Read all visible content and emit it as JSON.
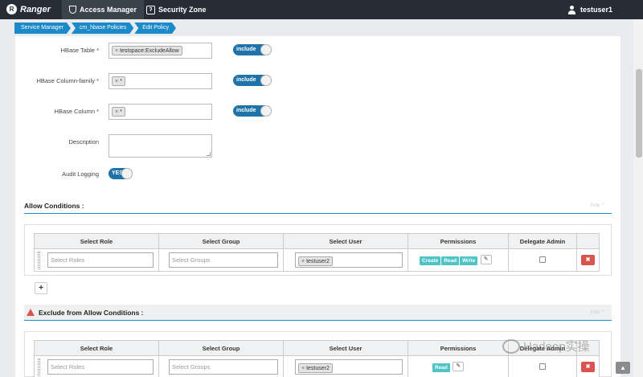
{
  "topnav": {
    "brand": "Ranger",
    "access_manager": "Access Manager",
    "security_zone": "Security Zone",
    "user": "testuser1"
  },
  "breadcrumb": [
    "Service Manager",
    "cm_hbase Policies",
    "Edit Policy"
  ],
  "form": {
    "hbase_table_label": "HBase Table *",
    "hbase_table_value": "testspace:ExcludeAllow",
    "hbase_table_toggle": "include",
    "column_family_label": "HBase Column-family *",
    "column_family_value": "*",
    "column_family_toggle": "include",
    "column_label": "HBase Column *",
    "column_value": "*",
    "column_toggle": "include",
    "description_label": "Description",
    "description_value": "",
    "audit_label": "Audit Logging",
    "audit_toggle": "YES"
  },
  "allow": {
    "title": "Allow Conditions :",
    "hide": "hide",
    "headers": [
      "Select Role",
      "Select Group",
      "Select User",
      "Permissions",
      "Delegate Admin"
    ],
    "row": {
      "role_placeholder": "Select Roles",
      "group_placeholder": "Select Groups",
      "user": "testuser2",
      "permissions": [
        "Create",
        "Read",
        "Write"
      ],
      "delegate_admin": false
    },
    "add": "+"
  },
  "exclude": {
    "title": "Exclude from Allow Conditions :",
    "hide": "hide",
    "headers": [
      "Select Role",
      "Select Group",
      "Select User",
      "Permissions",
      "Delegate Admin"
    ],
    "row": {
      "role_placeholder": "Select Roles",
      "group_placeholder": "Select Groups",
      "user": "testuser2",
      "permissions": [
        "Read"
      ],
      "delegate_admin": false
    }
  },
  "watermark": "Hadoop实操",
  "icons": {
    "pencil": "✎",
    "delete": "✖",
    "scroll_top": "▲",
    "tag_remove": "×"
  }
}
